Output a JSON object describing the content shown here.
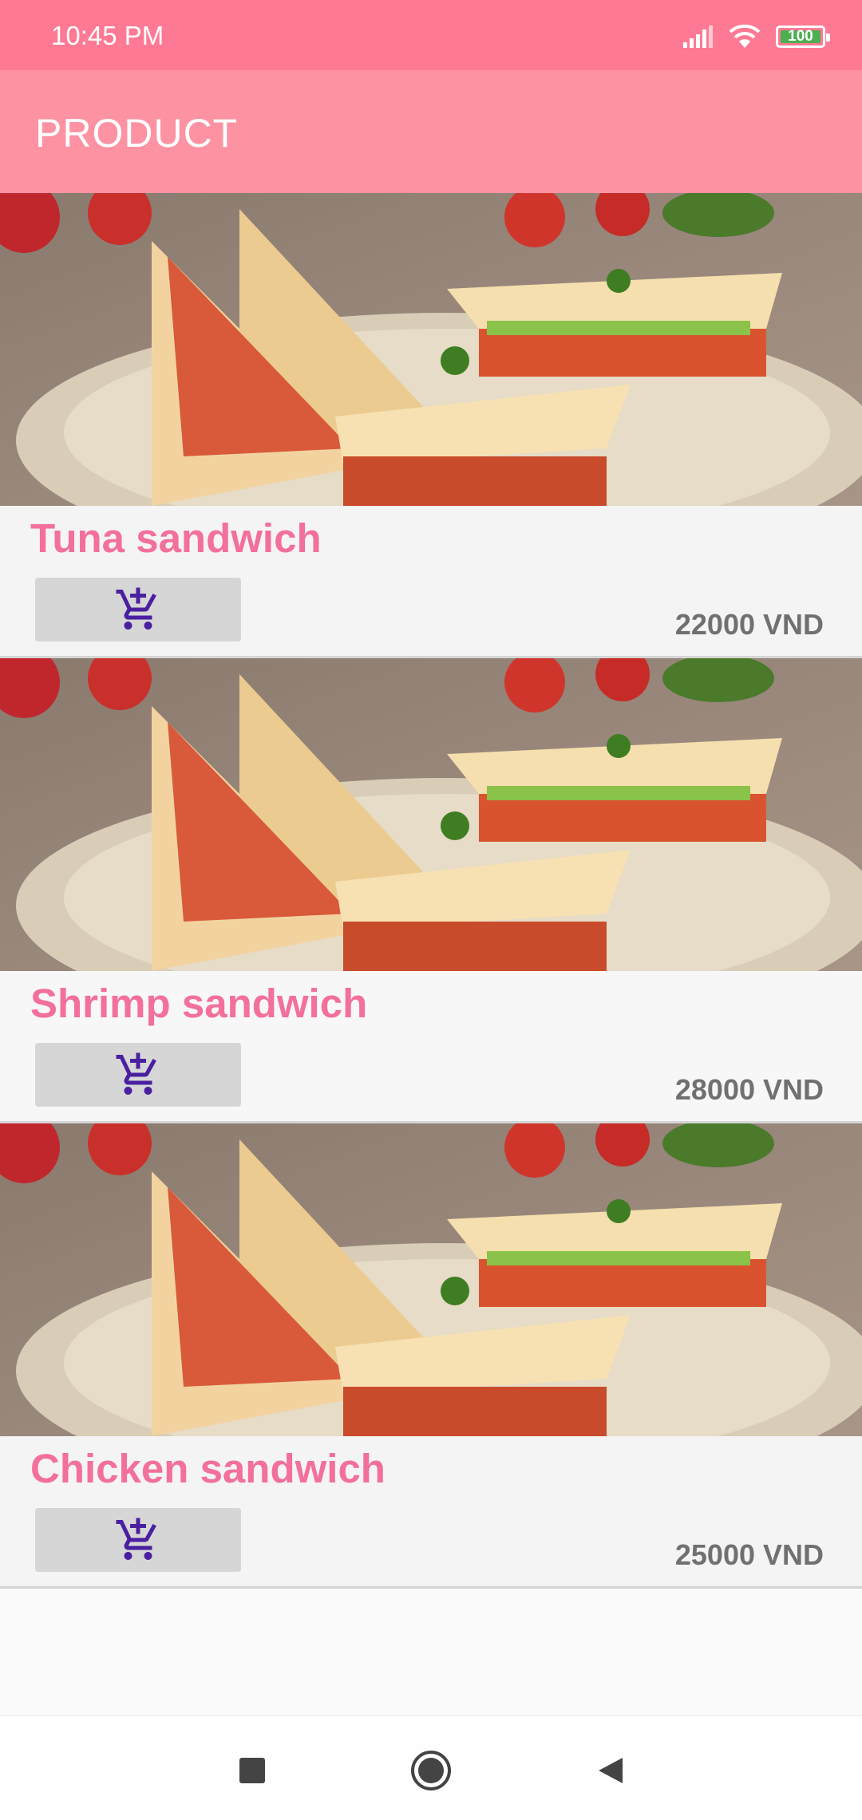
{
  "status_bar": {
    "time": "10:45 PM",
    "battery_level": "100",
    "icons": [
      "signal-icon",
      "wifi-icon",
      "battery-icon"
    ]
  },
  "app_bar": {
    "title": "PRODUCT"
  },
  "products": [
    {
      "name": "Tuna sandwich",
      "price": "22000 VND",
      "cart_icon": "add-to-cart-icon"
    },
    {
      "name": "Shrimp sandwich",
      "price": "28000 VND",
      "cart_icon": "add-to-cart-icon"
    },
    {
      "name": "Chicken sandwich",
      "price": "25000 VND",
      "cart_icon": "add-to-cart-icon"
    }
  ],
  "nav_bar": {
    "icons": [
      "recent-apps-icon",
      "home-icon",
      "back-icon"
    ]
  },
  "colors": {
    "status_bar": "#fe7993",
    "app_bar": "#fd92a3",
    "product_name": "#f2709a",
    "cart_icon": "#4a1fa0"
  }
}
